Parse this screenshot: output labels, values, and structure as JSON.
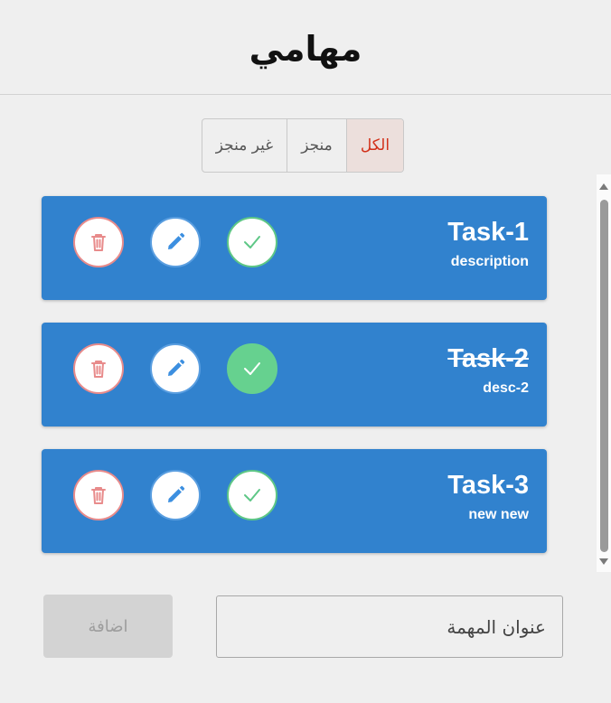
{
  "header": {
    "title": "مهامي"
  },
  "filters": {
    "all": "الكل",
    "done": "منجز",
    "not_done": "غير منجز"
  },
  "tasks": [
    {
      "title": "Task-1",
      "description": "description",
      "completed": false
    },
    {
      "title": "Task-2",
      "description": "desc-2",
      "completed": true
    },
    {
      "title": "Task-3",
      "description": "new new",
      "completed": false
    }
  ],
  "form": {
    "placeholder": "عنوان المهمة",
    "add_label": "اضافة"
  },
  "icons": {
    "delete": "trash-icon",
    "edit": "pencil-icon",
    "complete": "check-icon"
  },
  "colors": {
    "card": "#3182ce",
    "delete": "#e88b8b",
    "edit": "#5a9ee0",
    "complete": "#5ec786",
    "complete_active": "#66d18f",
    "active_filter_text": "#d2311a",
    "active_filter_bg": "#ecdfdc"
  }
}
